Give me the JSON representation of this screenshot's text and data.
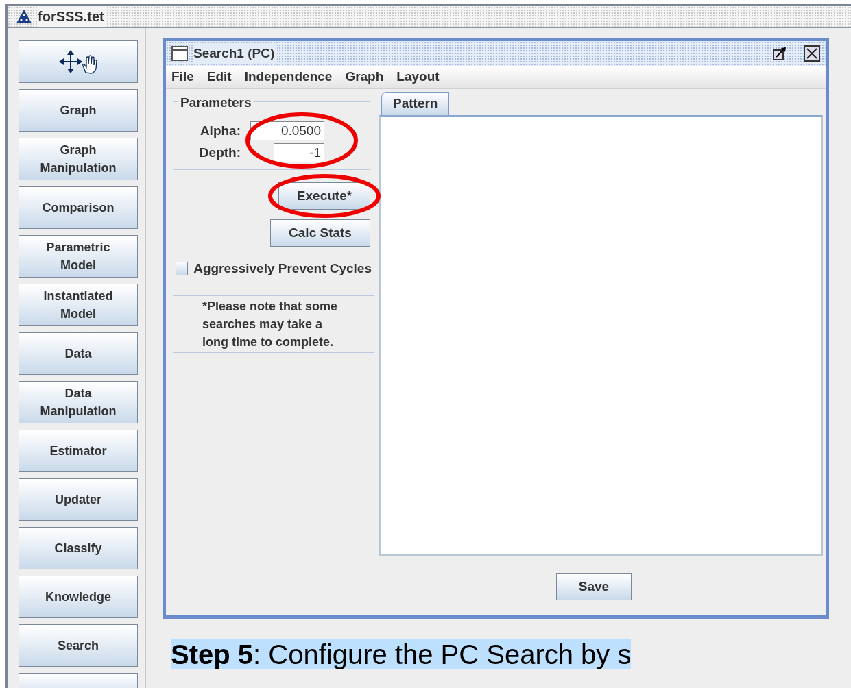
{
  "window": {
    "title": "forSSS.tet"
  },
  "sidebar": {
    "items": [
      {
        "kind": "tool"
      },
      {
        "kind": "text",
        "label": "Graph"
      },
      {
        "kind": "text",
        "label": "Graph\nManipulation"
      },
      {
        "kind": "text",
        "label": "Comparison"
      },
      {
        "kind": "text",
        "label": "Parametric\nModel"
      },
      {
        "kind": "text",
        "label": "Instantiated\nModel"
      },
      {
        "kind": "text",
        "label": "Data"
      },
      {
        "kind": "text",
        "label": "Data\nManipulation"
      },
      {
        "kind": "text",
        "label": "Estimator"
      },
      {
        "kind": "text",
        "label": "Updater"
      },
      {
        "kind": "text",
        "label": "Classify"
      },
      {
        "kind": "text",
        "label": "Knowledge"
      },
      {
        "kind": "text",
        "label": "Search"
      },
      {
        "kind": "blank"
      }
    ]
  },
  "search_window": {
    "title": "Search1 (PC)",
    "menu": [
      "File",
      "Edit",
      "Independence",
      "Graph",
      "Layout"
    ],
    "parameters": {
      "legend": "Parameters",
      "fields": [
        {
          "label": "Alpha:",
          "value": "0.0500"
        },
        {
          "label": "Depth:",
          "value": "-1"
        }
      ]
    },
    "buttons": [
      "Execute*",
      "Calc Stats"
    ],
    "checkbox": {
      "label": "Aggressively Prevent Cycles",
      "checked": false
    },
    "note": "*Please note that some\nsearches may take a\nlong time to complete.",
    "tabs": [
      {
        "label": "Pattern",
        "selected": true
      }
    ],
    "save_button": "Save"
  },
  "caption": "**Step 5**: Configure the PC Search by s"
}
